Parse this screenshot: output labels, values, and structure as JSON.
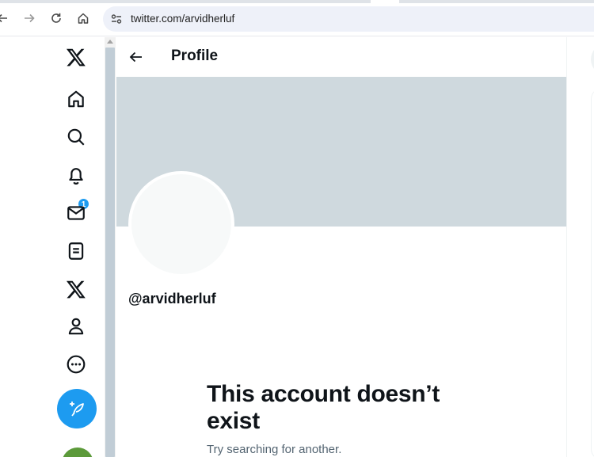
{
  "browser": {
    "url": "twitter.com/arvidherluf"
  },
  "nav": {
    "notification_count": "1",
    "items": [
      "home-icon",
      "explore-icon",
      "notifications-icon",
      "messages-icon",
      "lists-icon",
      "premium-icon",
      "profile-icon",
      "more-icon"
    ]
  },
  "profile": {
    "header_title": "Profile",
    "handle": "@arvidherluf",
    "empty_title": "This account doesn’t exist",
    "empty_subtitle": "Try searching for another."
  },
  "colors": {
    "accent": "#1d9bf0",
    "banner": "#cfd9de",
    "text_primary": "#0f1419",
    "text_secondary": "#536471"
  }
}
